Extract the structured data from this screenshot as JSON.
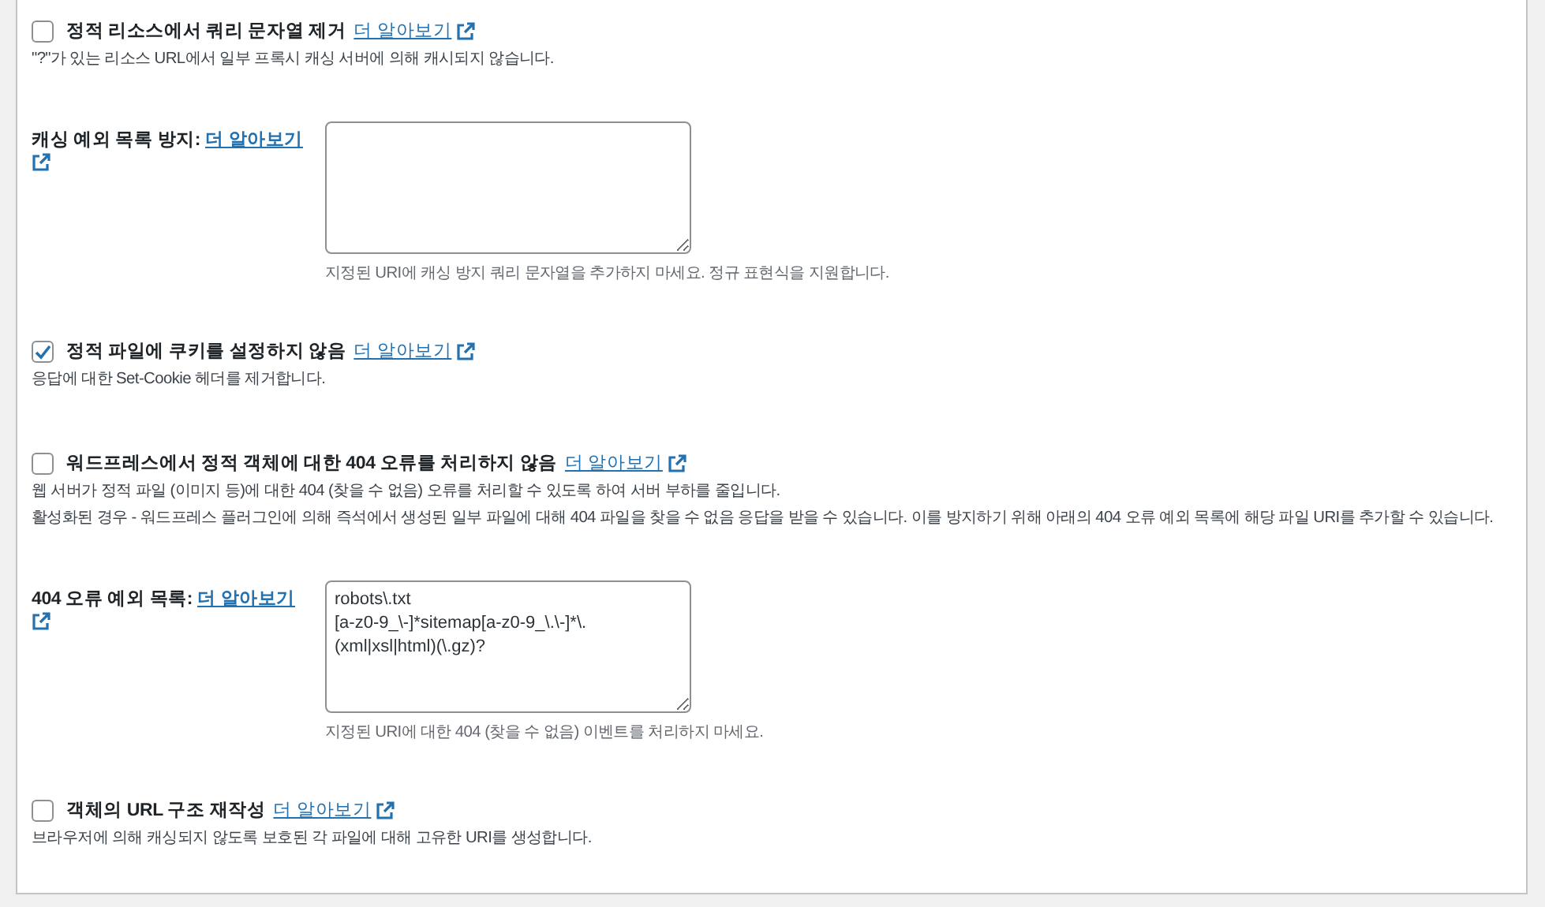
{
  "items": [
    {
      "kind": "checkbox",
      "label": "정적 리소스에서 쿼리 문자열 제거",
      "link": "더 알아보기",
      "checked": false,
      "descriptions": [
        "\"?\"가 있는 리소스 URL에서 일부 프록시 캐싱 서버에 의해 캐시되지 않습니다."
      ]
    },
    {
      "kind": "textarea",
      "label": "캐싱 예외 목록 방지:",
      "link": "더 알아보기",
      "value": "",
      "hint": "지정된 URI에 캐싱 방지 쿼리 문자열을 추가하지 마세요. 정규 표현식을 지원합니다."
    },
    {
      "kind": "checkbox",
      "label": "정적 파일에 쿠키를 설정하지 않음",
      "link": "더 알아보기",
      "checked": true,
      "descriptions": [
        "응답에 대한 Set-Cookie 헤더를 제거합니다."
      ]
    },
    {
      "kind": "checkbox",
      "label": "워드프레스에서 정적 객체에 대한 404 오류를 처리하지 않음",
      "link": "더 알아보기",
      "checked": false,
      "descriptions": [
        "웹 서버가 정적 파일 (이미지 등)에 대한 404 (찾을 수 없음) 오류를 처리할 수 있도록 하여 서버 부하를 줄입니다.",
        "활성화된 경우 - 워드프레스 플러그인에 의해 즉석에서 생성된 일부 파일에 대해 404 파일을 찾을 수 없음 응답을 받을 수 있습니다. 이를 방지하기 위해 아래의 404 오류 예외 목록에 해당 파일 URI를 추가할 수 있습니다."
      ]
    },
    {
      "kind": "textarea",
      "label": "404 오류 예외 목록:",
      "link": "더 알아보기",
      "value": "robots\\.txt\n[a-z0-9_\\-]*sitemap[a-z0-9_\\.\\-]*\\.(xml|xsl|html)(\\.gz)?",
      "hint": "지정된 URI에 대한 404 (찾을 수 없음) 이벤트를 처리하지 마세요."
    },
    {
      "kind": "checkbox",
      "label": "객체의 URL 구조 재작성",
      "link": "더 알아보기",
      "checked": false,
      "descriptions": [
        "브라우저에 의해 캐싱되지 않도록 보호된 각 파일에 대해 고유한 URI를 생성합니다."
      ]
    }
  ]
}
